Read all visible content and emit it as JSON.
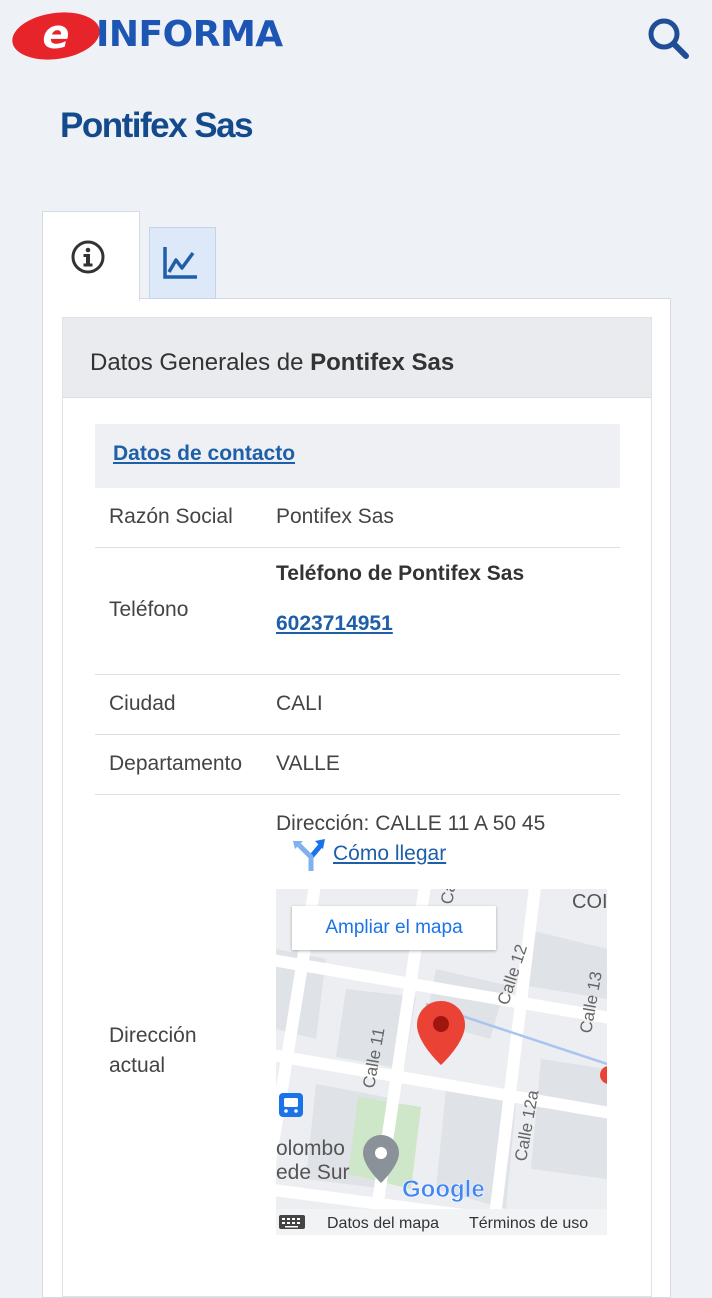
{
  "header": {
    "logo_text": "INFORMA",
    "logo_e": "e"
  },
  "page": {
    "title": "Pontifex Sas"
  },
  "tabs": [
    {
      "name": "info",
      "icon": "info-circle-icon",
      "active": true
    },
    {
      "name": "chart",
      "icon": "line-chart-icon",
      "active": false
    }
  ],
  "card": {
    "title_prefix": "Datos Generales de ",
    "title_company": "Pontifex Sas",
    "section_title": "Datos de contacto",
    "rows": {
      "razon_label": "Razón Social",
      "razon_value": "Pontifex Sas",
      "telefono_label": "Teléfono",
      "telefono_heading": "Teléfono de Pontifex Sas",
      "telefono_value": "6023714951",
      "ciudad_label": "Ciudad",
      "ciudad_value": "CALI",
      "departamento_label": "Departamento",
      "departamento_value": "VALLE",
      "direccion_label_1": "Dirección",
      "direccion_label_2": "actual",
      "direccion_value": "Dirección: CALLE 11 A 50 45",
      "como_llegar": "Cómo llegar"
    }
  },
  "map": {
    "enlarge_button": "Ampliar el mapa",
    "streets": [
      "Calle 11",
      "Calle 12",
      "Calle 12a",
      "Calle 13",
      "Calle"
    ],
    "place_label_1": "olombo",
    "place_label_2": "ede Sur",
    "corner_label": "COI",
    "google_logo": "Google",
    "map_data_link": "Datos del mapa",
    "terms_link": "Términos de uso"
  },
  "colors": {
    "brand_blue": "#1d55b4",
    "title_blue": "#134a8c",
    "link_blue": "#1e5fa8",
    "logo_red": "#e8242b",
    "pin_red": "#ea4335"
  }
}
